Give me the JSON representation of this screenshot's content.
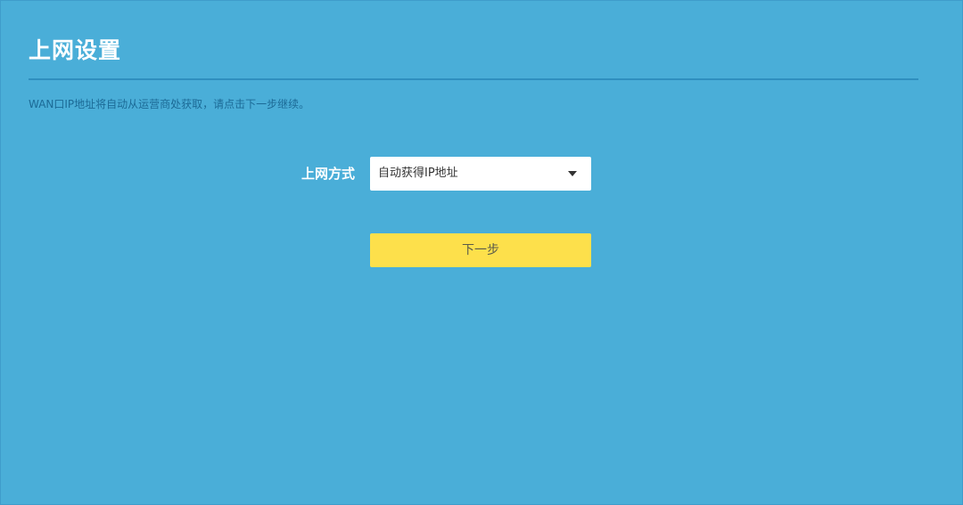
{
  "header": {
    "title": "上网设置"
  },
  "hint_text": "WAN口IP地址将自动从运营商处获取，请点击下一步继续。",
  "form": {
    "connection_type_label": "上网方式",
    "connection_type_value": "自动获得IP地址"
  },
  "actions": {
    "next_label": "下一步"
  },
  "colors": {
    "background": "#4aaed8",
    "divider": "#2f8fbf",
    "hint_text": "#1c6a96",
    "button": "#fde04b"
  },
  "icons": {
    "select_caret": "chevron-down-icon"
  }
}
